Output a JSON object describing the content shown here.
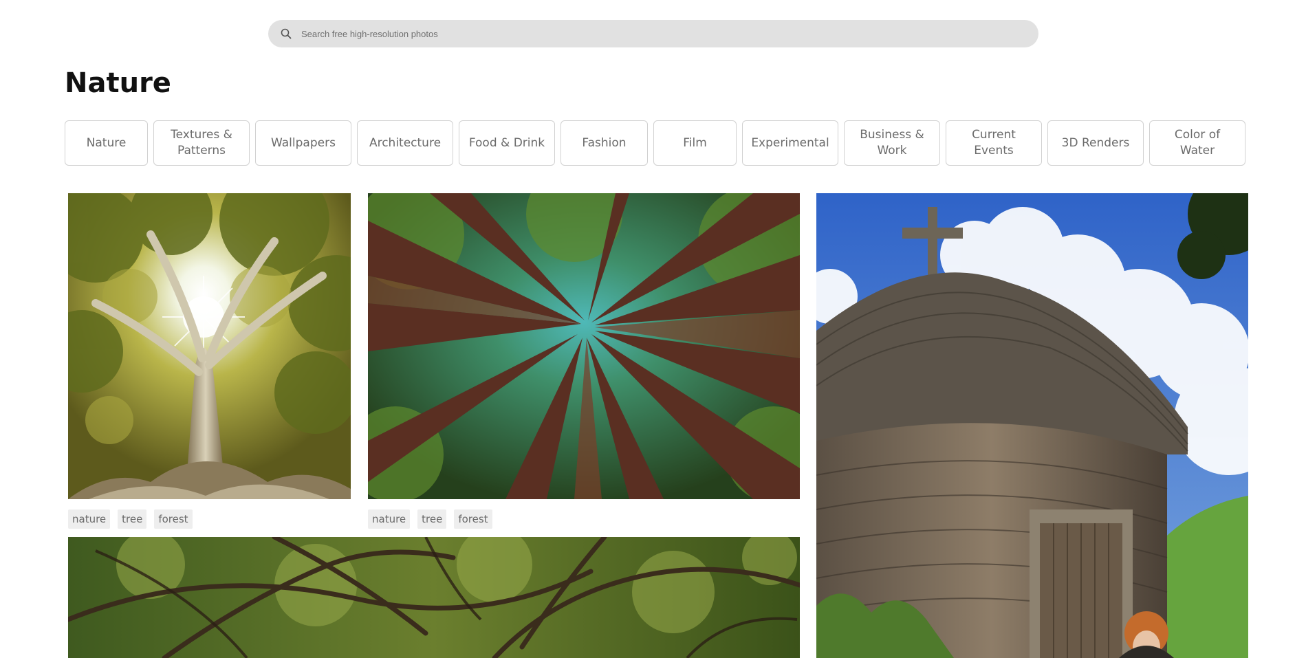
{
  "search": {
    "placeholder": "Search free high-resolution photos",
    "icon": "search-icon"
  },
  "page": {
    "title": "Nature"
  },
  "topics": [
    {
      "label": "Nature"
    },
    {
      "label": "Textures & Patterns"
    },
    {
      "label": "Wallpapers"
    },
    {
      "label": "Architecture"
    },
    {
      "label": "Food & Drink"
    },
    {
      "label": "Fashion"
    },
    {
      "label": "Film"
    },
    {
      "label": "Experimental"
    },
    {
      "label": "Business & Work"
    },
    {
      "label": "Current Events"
    },
    {
      "label": "3D Renders"
    },
    {
      "label": "Color of Water"
    }
  ],
  "photos": [
    {
      "tags": [
        "nature",
        "tree",
        "forest"
      ]
    },
    {
      "tags": [
        "nature",
        "tree",
        "forest"
      ]
    },
    {
      "tags": []
    },
    {
      "tags": []
    }
  ],
  "colors": {
    "search_bg": "#e1e1e1",
    "chip_border": "#d1d1d1",
    "chip_text": "#6b6b6b",
    "tag_bg": "#eeeeee"
  }
}
